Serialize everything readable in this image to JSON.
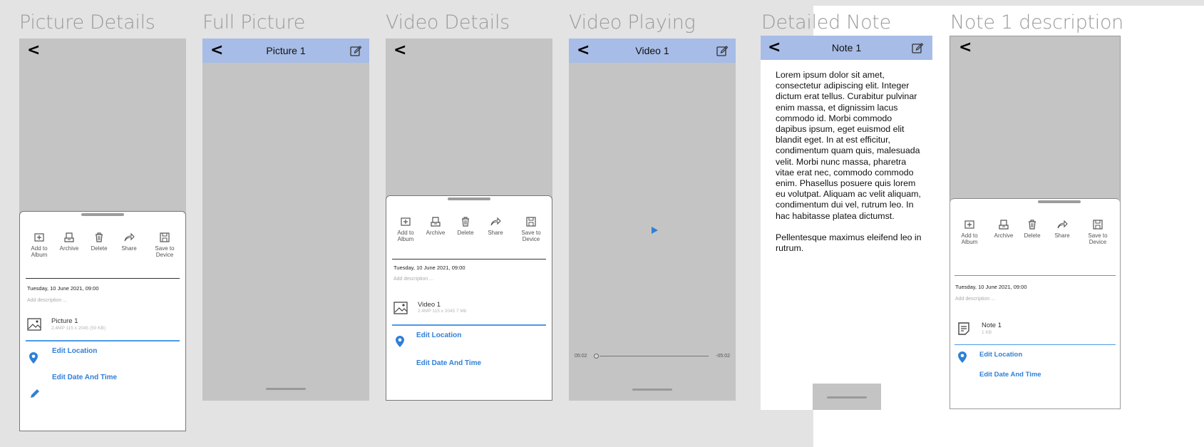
{
  "frames": {
    "picture_details": {
      "title": "Picture Details"
    },
    "full_picture": {
      "title": "Full Picture",
      "header": "Picture 1"
    },
    "video_details": {
      "title": "Video Details"
    },
    "video_playing": {
      "title": "Video Playing",
      "header": "Video 1",
      "time_start": "05:02",
      "time_end": "-05:02"
    },
    "detailed_note": {
      "title": "Detailed Note",
      "header": "Note 1",
      "body": "Lorem ipsum dolor sit amet, consectetur adipiscing elit. Integer dictum erat tellus. Curabitur pulvinar enim massa, et dignissim lacus commodo id. Morbi commodo dapibus ipsum, eget euismod elit blandit eget. In at est efficitur, condimentum quam quis, malesuada velit. Morbi nunc massa, pharetra vitae erat nec, commodo commodo enim. Phasellus posuere quis lorem eu volutpat. Aliquam ac velit aliquam, condimentum dui vel, rutrum leo. In hac habitasse platea dictumst.\n\nPellentesque maximus eleifend leo in rutrum."
    },
    "note_description": {
      "title": "Note 1 description"
    }
  },
  "actions": {
    "add_to_album": "Add to\nAlbum",
    "archive": "Archive",
    "delete": "Delete",
    "share": "Share",
    "save_to_device": "Save to\nDevice"
  },
  "details": {
    "date": "Tuesday, 10 June 2021, 09:00",
    "add_description_placeholder": "Add description ...",
    "picture_name": "Picture 1",
    "picture_meta": "2.4MP 115 x 2045 (50 KB)",
    "video_name": "Video 1",
    "video_meta": "2.4MP 115 x 2045 7 Mb",
    "note_name": "Note 1",
    "note_meta": "1 KB",
    "edit_location": "Edit Location",
    "edit_date_time": "Edit Date And Time"
  },
  "colors": {
    "header_bar": "#a7bce7",
    "accent": "#2f7fd8",
    "canvas": "#c4c4c4"
  },
  "icons": [
    "back-chevron-icon",
    "edit-icon",
    "add-to-album-icon",
    "archive-icon",
    "delete-icon",
    "share-icon",
    "save-icon",
    "image-icon",
    "note-icon",
    "location-pin-icon",
    "pencil-icon",
    "play-icon"
  ]
}
